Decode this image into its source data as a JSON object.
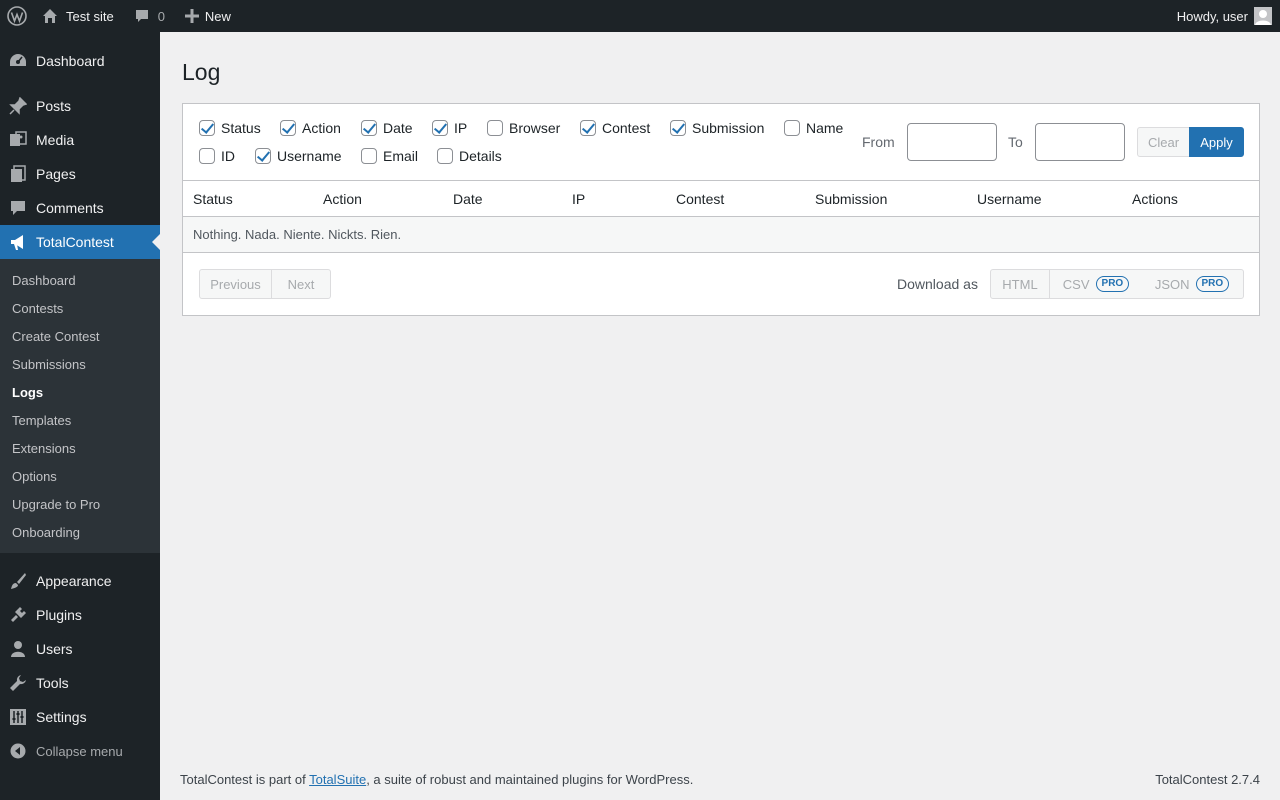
{
  "adminbar": {
    "site_name": "Test site",
    "comments_count": "0",
    "new_label": "New",
    "greeting": "Howdy, user"
  },
  "sidebar": {
    "top_items": [
      {
        "label": "Dashboard",
        "icon": "dashboard-icon"
      },
      {
        "label": "Posts",
        "icon": "pin-icon"
      },
      {
        "label": "Media",
        "icon": "media-icon"
      },
      {
        "label": "Pages",
        "icon": "pages-icon"
      },
      {
        "label": "Comments",
        "icon": "comment-icon"
      },
      {
        "label": "TotalContest",
        "icon": "megaphone-icon"
      }
    ],
    "submenu": [
      "Dashboard",
      "Contests",
      "Create Contest",
      "Submissions",
      "Logs",
      "Templates",
      "Extensions",
      "Options",
      "Upgrade to Pro",
      "Onboarding"
    ],
    "current_submenu": "Logs",
    "bottom_items": [
      {
        "label": "Appearance",
        "icon": "brush-icon"
      },
      {
        "label": "Plugins",
        "icon": "plug-icon"
      },
      {
        "label": "Users",
        "icon": "user-icon"
      },
      {
        "label": "Tools",
        "icon": "wrench-icon"
      },
      {
        "label": "Settings",
        "icon": "sliders-icon"
      }
    ],
    "collapse_label": "Collapse menu"
  },
  "page": {
    "title": "Log"
  },
  "filters": {
    "columns": [
      {
        "label": "Status",
        "checked": true
      },
      {
        "label": "Action",
        "checked": true
      },
      {
        "label": "Date",
        "checked": true
      },
      {
        "label": "IP",
        "checked": true
      },
      {
        "label": "Browser",
        "checked": false
      },
      {
        "label": "Contest",
        "checked": true
      },
      {
        "label": "Submission",
        "checked": true
      },
      {
        "label": "Name",
        "checked": false
      },
      {
        "label": "ID",
        "checked": false
      },
      {
        "label": "Username",
        "checked": true
      },
      {
        "label": "Email",
        "checked": false
      },
      {
        "label": "Details",
        "checked": false
      }
    ],
    "from_label": "From",
    "to_label": "To",
    "from_value": "",
    "to_value": "",
    "clear_label": "Clear",
    "apply_label": "Apply"
  },
  "table": {
    "headers": [
      "Status",
      "Action",
      "Date",
      "IP",
      "Contest",
      "Submission",
      "Username",
      "Actions"
    ],
    "empty_message": "Nothing. Nada. Niente. Nickts. Rien."
  },
  "pager": {
    "previous_label": "Previous",
    "next_label": "Next",
    "download_label": "Download as",
    "formats": [
      {
        "label": "HTML",
        "pro": false
      },
      {
        "label": "CSV",
        "pro": true
      },
      {
        "label": "JSON",
        "pro": true
      }
    ],
    "pro_badge": "PRO"
  },
  "footer": {
    "text_before": "TotalContest is part of ",
    "link_text": "TotalSuite",
    "text_after": ", a suite of robust and maintained plugins for WordPress.",
    "version": "TotalContest 2.7.4"
  },
  "colors": {
    "accent": "#2271b1",
    "dark": "#1d2327",
    "background": "#f0f0f1"
  }
}
